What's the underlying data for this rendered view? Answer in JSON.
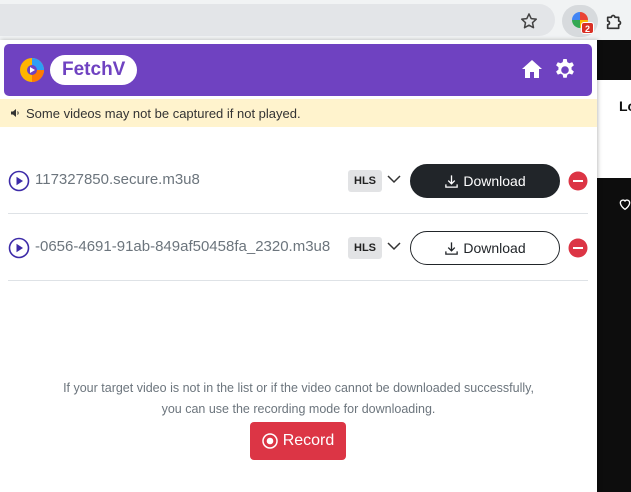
{
  "extension": {
    "badge_count": "2"
  },
  "header": {
    "brand": "FetchV",
    "accent_color": "#6f42c1"
  },
  "notice": {
    "text": "Some videos may not be captured if not played."
  },
  "videos": [
    {
      "filename": "117327850.secure.m3u8",
      "format": "HLS",
      "download_label": "Download",
      "style": "dark"
    },
    {
      "filename": "-0656-4691-91ab-849af50458fa_2320.m3u8",
      "format": "HLS",
      "download_label": "Download",
      "style": "light"
    }
  ],
  "help": {
    "line1": "If your target video is not in the list or if the video cannot be downloaded successfully,",
    "line2": "you can use the recording mode for downloading."
  },
  "record": {
    "label": "Record",
    "color": "#dc3545"
  },
  "background_page": {
    "text": "Lo"
  },
  "icons": [
    "star-icon",
    "puzzle-icon",
    "home-icon",
    "gear-icon",
    "speaker-icon",
    "play-icon",
    "chevron-down-icon",
    "download-icon",
    "remove-icon",
    "record-icon",
    "heart-icon"
  ]
}
